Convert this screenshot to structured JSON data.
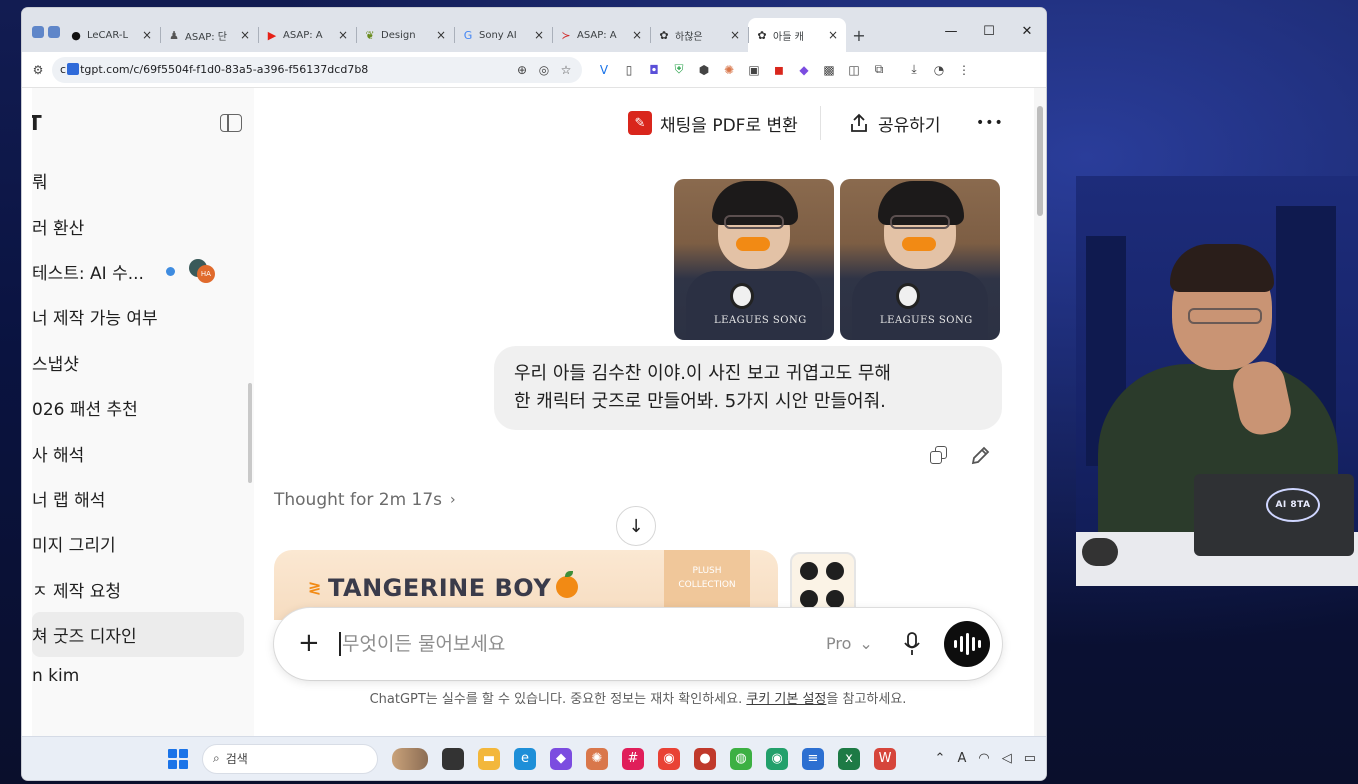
{
  "browser": {
    "tabs": [
      {
        "icon": "github-icon",
        "glyph": "●",
        "label": "LeCAR-L",
        "color": "#111111"
      },
      {
        "icon": "asap-figure-icon",
        "glyph": "♟",
        "label": "ASAP: 단",
        "color": "#555555"
      },
      {
        "icon": "youtube-icon",
        "glyph": "▶",
        "label": "ASAP: A",
        "color": "#e62117"
      },
      {
        "icon": "design-leaf-icon",
        "glyph": "❦",
        "label": "Design",
        "color": "#6a8c1f"
      },
      {
        "icon": "google-icon",
        "glyph": "G",
        "label": "Sony AI",
        "color": "#4285f4"
      },
      {
        "icon": "asap-red-icon",
        "glyph": "≻",
        "label": "ASAP: A",
        "color": "#d12a2a"
      },
      {
        "icon": "chatgpt-icon",
        "glyph": "✿",
        "label": "하찮은",
        "color": "#333333"
      },
      {
        "icon": "chatgpt-icon",
        "glyph": "✿",
        "label": "아들 캐",
        "color": "#333333",
        "active": true
      }
    ],
    "new_tab": "+",
    "url": "tgpt.com/c/69f5504f-f1d0-83a5-a396-f56137dcd7b8",
    "url_prefix": "c"
  },
  "sidebar": {
    "brand": "T",
    "items": [
      {
        "label": "뤄"
      },
      {
        "label": "러 환산"
      },
      {
        "label": "테스트: AI 수...",
        "group": true,
        "group_badge": "HA"
      },
      {
        "label": "너 제작 가능 여부"
      },
      {
        "label": "스냅샷"
      },
      {
        "label": "026 패션 추천"
      },
      {
        "label": "사 해석"
      },
      {
        "label": "너 랩 해석"
      },
      {
        "label": "미지 그리기"
      },
      {
        "label": "ㅈ 제작 요청"
      },
      {
        "label": "쳐 굿즈 디자인",
        "selected": true
      }
    ],
    "user": "n kim"
  },
  "header": {
    "pdf_label": "채팅을 PDF로 변환",
    "share_label": "공유하기",
    "more_label": "•••"
  },
  "conversation": {
    "photo_shirt_text": "LEAGUES SONG",
    "user_message_line1": "우리 아들 김수찬 이야.이 사진 보고 귀엽고도 무해",
    "user_message_line2": "한 캐릭터 굿즈로 만들어봐. 5가지 시안 만들어줘.",
    "thought_label": "Thought for 2m 17s",
    "generated_title": "TANGERINE BOY",
    "generated_side": "PLUSH COLLECTION"
  },
  "composer": {
    "placeholder": "무엇이든 물어보세요",
    "model": "Pro"
  },
  "disclaimer": {
    "text": "ChatGPT는 실수를 할 수 있습니다. 중요한 정보는 재차 확인하세요. ",
    "link": "쿠키 기본 설정",
    "suffix": "을 참고하세요."
  },
  "taskbar": {
    "search_label": "검색",
    "apps": [
      {
        "icon": "windows-folder-icon",
        "color": "#f3b73b",
        "glyph": "▬"
      },
      {
        "icon": "edge-icon",
        "color": "#1e8fd8",
        "glyph": "e"
      },
      {
        "icon": "app-purple-icon",
        "color": "#7b4ce0",
        "glyph": "◆"
      },
      {
        "icon": "claude-icon",
        "color": "#d9774b",
        "glyph": "✺"
      },
      {
        "icon": "slack-icon",
        "color": "#e01e5a",
        "glyph": "#"
      },
      {
        "icon": "chrome-icon",
        "color": "#e94235",
        "glyph": "◉"
      },
      {
        "icon": "app-red-icon",
        "color": "#c0392b",
        "glyph": "●"
      },
      {
        "icon": "kakao-icon",
        "color": "#3cb043",
        "glyph": "◍"
      },
      {
        "icon": "chrome-dev-icon",
        "color": "#22a06b",
        "glyph": "◉"
      },
      {
        "icon": "notepad-icon",
        "color": "#2c6fd1",
        "glyph": "≡"
      },
      {
        "icon": "excel-icon",
        "color": "#1d7a45",
        "glyph": "x"
      },
      {
        "icon": "app-stripes-icon",
        "color": "#d6453b",
        "glyph": "W"
      }
    ],
    "tray_font_label": "A"
  },
  "webcam": {
    "laptop_logo": "AI 8TA"
  }
}
